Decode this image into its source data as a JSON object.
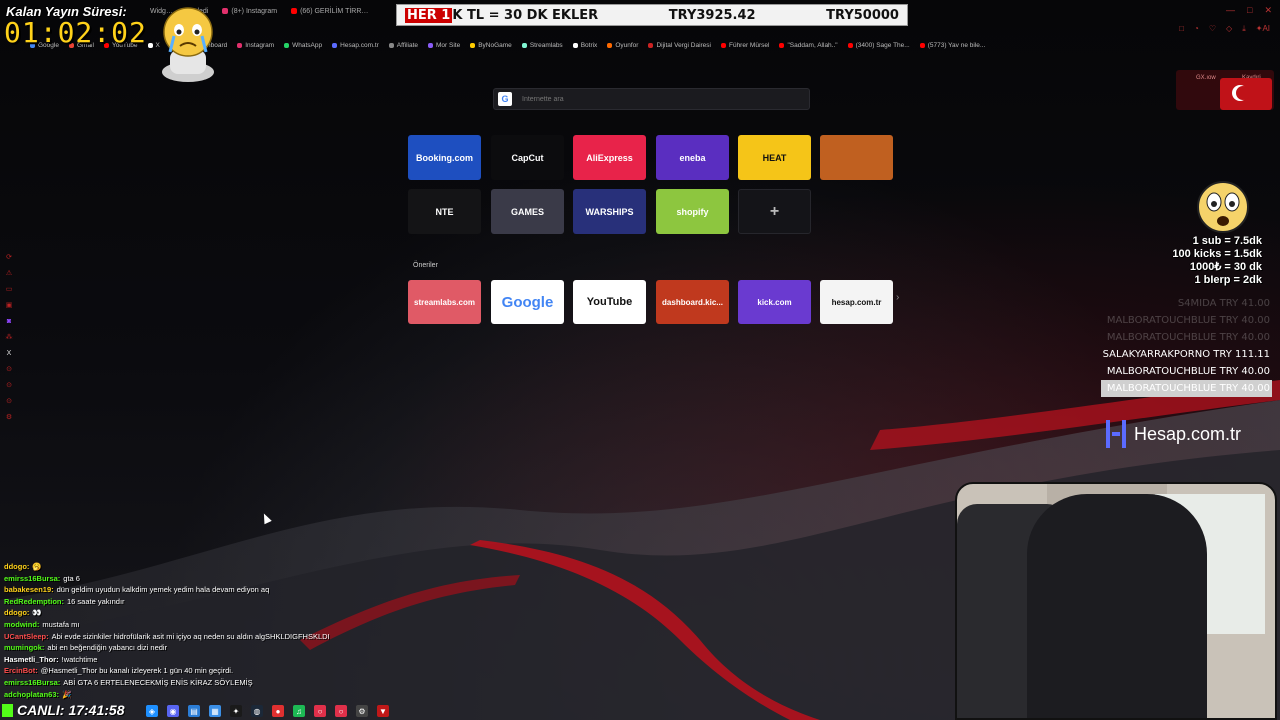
{
  "browser": {
    "tabs": [
      {
        "label": "Widg…"
      },
      {
        "label": "…cledi"
      },
      {
        "label": "(8+) Instagram"
      },
      {
        "label": "(66) GERİLİM TİRR…"
      }
    ],
    "bookmarks": [
      {
        "label": "Google",
        "color": "#4285f4"
      },
      {
        "label": "Gmail",
        "color": "#ea4335"
      },
      {
        "label": "YouTube",
        "color": "#ff0000"
      },
      {
        "label": "X",
        "color": "#ffffff"
      },
      {
        "label": "Kick | Dashboard",
        "color": "#53fc18"
      },
      {
        "label": "Instagram",
        "color": "#e1306c"
      },
      {
        "label": "WhatsApp",
        "color": "#25d366"
      },
      {
        "label": "Hesap.com.tr",
        "color": "#5b6bff"
      },
      {
        "label": "Affiliate",
        "color": "#888888"
      },
      {
        "label": "Mor Site",
        "color": "#8a5cf6"
      },
      {
        "label": "ByNoGame",
        "color": "#ffcc00"
      },
      {
        "label": "Streamlabs",
        "color": "#80f5d2"
      },
      {
        "label": "Botrix",
        "color": "#ffffff"
      },
      {
        "label": "Oyunfor",
        "color": "#ff6a00"
      },
      {
        "label": "Dijital Vergi Dairesi",
        "color": "#cc2222"
      },
      {
        "label": "Führer Mürsel",
        "color": "#ff0000"
      },
      {
        "label": "\"Saddam, Allah..\"",
        "color": "#ff0000"
      },
      {
        "label": "(3400) Sage The...",
        "color": "#ff0000"
      },
      {
        "label": "(5773) Yav ne bile...",
        "color": "#ff0000"
      }
    ],
    "search_placeholder": "İnternette ara",
    "search_icon_letter": "G",
    "speed_dial": [
      {
        "label": "Booking.com",
        "bg": "#1e4fc0",
        "fg": "#ffffff"
      },
      {
        "label": "CapCut",
        "bg": "#0c0c0e",
        "fg": "#ffffff"
      },
      {
        "label": "AliExpress",
        "bg": "#e8234a",
        "fg": "#ffffff"
      },
      {
        "label": "eneba",
        "bg": "#5a2ec0",
        "fg": "#ffffff"
      },
      {
        "label": "HEAT",
        "bg": "#f5c518",
        "fg": "#111111"
      },
      {
        "label": "",
        "bg": "#c06020",
        "fg": "#ffffff"
      },
      {
        "label": "NTE",
        "bg": "#141416",
        "fg": "#ffffff"
      },
      {
        "label": "GAMES",
        "bg": "#3a3a48",
        "fg": "#ffffff"
      },
      {
        "label": "WARSHIPS",
        "bg": "#28307a",
        "fg": "#ffffff"
      },
      {
        "label": "shopify",
        "bg": "#8dc63f",
        "fg": "#ffffff"
      },
      {
        "label": "+",
        "bg": "#141418",
        "fg": "#bbbbbb"
      }
    ],
    "suggestions_label": "Öneriler",
    "suggestions": [
      {
        "label": "streamlabs.com",
        "bg": "#e05a66",
        "fg": "#ffffff"
      },
      {
        "label": "Google",
        "bg": "#ffffff",
        "fg": "#4285f4"
      },
      {
        "label": "YouTube",
        "bg": "#ffffff",
        "fg": "#111111"
      },
      {
        "label": "dashboard.kic...",
        "bg": "#c0391e",
        "fg": "#ffffff"
      },
      {
        "label": "kick.com",
        "bg": "#6a3ad0",
        "fg": "#ffffff"
      },
      {
        "label": "hesap.com.tr",
        "bg": "#f4f4f4",
        "fg": "#111111"
      }
    ],
    "more_arrow": "›",
    "gx_chip_a": "GX.ıow",
    "gx_chip_b": "Kaydıri",
    "window_controls": [
      "—",
      "□",
      "✕"
    ],
    "tool_icons": [
      "□",
      "◔",
      "♡",
      "◇",
      "⤓",
      "✦AI"
    ]
  },
  "overlay": {
    "timer_label": "Kalan Yayın Süresi:",
    "timer": "01:02:02",
    "ticker_lead_red": "HER 1",
    "ticker_lead_rest": "K TL = 30 DK EKLER",
    "ticker_current": "TRY3925.42",
    "ticker_goal": "TRY50000",
    "rates": [
      "1 sub = 7.5dk",
      "100 kicks = 1.5dk",
      "1000₺ = 30 dk",
      "1 bIerp = 2dk"
    ],
    "donations": [
      {
        "name": "S4MIDA",
        "amount": "TRY 41.00",
        "style": "faded"
      },
      {
        "name": "MALBORATOUCHBLUE",
        "amount": "TRY 40.00",
        "style": "faded"
      },
      {
        "name": "MALBORATOUCHBLUE",
        "amount": "TRY 40.00",
        "style": "faded"
      },
      {
        "name": "SALAKYARRAKPORNO",
        "amount": "TRY 111.11",
        "style": "normal"
      },
      {
        "name": "MALBORATOUCHBLUE",
        "amount": "TRY 40.00",
        "style": "normal"
      },
      {
        "name": "MALBORATOUCHBLUE",
        "amount": "TRY 40.00",
        "style": "hl"
      }
    ],
    "sponsor": "Hesap.com.tr",
    "live_label": "CANLI:",
    "live_time": "17:41:58"
  },
  "chat": [
    {
      "user": "ddogo:",
      "color": "#ffd21a",
      "text": "🥱"
    },
    {
      "user": "emirss16Bursa:",
      "color": "#53fc18",
      "text": "gta 6"
    },
    {
      "user": "babakesen19:",
      "color": "#ffd21a",
      "text": "dün geldim uyudun kalkdim yemek yedim hala devam ediyon aq"
    },
    {
      "user": "RedRedemption:",
      "color": "#53fc18",
      "text": "16 saate yakındır"
    },
    {
      "user": "ddogo:",
      "color": "#ffd21a",
      "text": "👀"
    },
    {
      "user": "modwind:",
      "color": "#53fc18",
      "text": "mustafa mı"
    },
    {
      "user": "UCantSleep:",
      "color": "#ff4d4d",
      "text": "Abi evde sizinkiler hidrofülarik asit mi içiyo aq neden su aldın algSHKLDIGFHSKLDI"
    },
    {
      "user": "mumingok:",
      "color": "#53fc18",
      "text": "abi en beğendiğin yabancı dizi nedir"
    },
    {
      "user": "Hasmetli_Thor:",
      "color": "#ffffff",
      "text": "!watchtime"
    },
    {
      "user": "ErcinBot:",
      "color": "#ff4d4d",
      "text": "@Hasmetli_Thor bu kanalı izleyerek 1 gün 40 min geçirdi."
    },
    {
      "user": "emirss16Bursa:",
      "color": "#53fc18",
      "text": "ABİ GTA 6 ERTELENECEKMİŞ ENİS KİRAZ SÖYLEMİŞ"
    },
    {
      "user": "adchoplatan63:",
      "color": "#53fc18",
      "text": "🎉"
    }
  ],
  "sidebar_icons": [
    "⟳",
    "⚠",
    "▭",
    "▣",
    "◙",
    "⁂",
    "X",
    "⊙",
    "⊙",
    "⊙",
    "⚙"
  ],
  "taskbar": [
    {
      "name": "start",
      "glyph": "◈",
      "color": "#1e90ff"
    },
    {
      "name": "discord",
      "glyph": "◉",
      "color": "#5865f2"
    },
    {
      "name": "explorer",
      "glyph": "▤",
      "color": "#2b7dd6"
    },
    {
      "name": "app",
      "glyph": "▦",
      "color": "#3b8fe6"
    },
    {
      "name": "app2",
      "glyph": "✦",
      "color": "#1a1a1a"
    },
    {
      "name": "steam",
      "glyph": "◍",
      "color": "#1b2838"
    },
    {
      "name": "recorder",
      "glyph": "●",
      "color": "#e03030"
    },
    {
      "name": "spotify",
      "glyph": "♫",
      "color": "#1db954"
    },
    {
      "name": "opera-gx-1",
      "glyph": "○",
      "color": "#e0304a"
    },
    {
      "name": "opera-gx-2",
      "glyph": "○",
      "color": "#e0304a"
    },
    {
      "name": "settings",
      "glyph": "⚙",
      "color": "#444444"
    },
    {
      "name": "red-app",
      "glyph": "▼",
      "color": "#c01818"
    }
  ]
}
